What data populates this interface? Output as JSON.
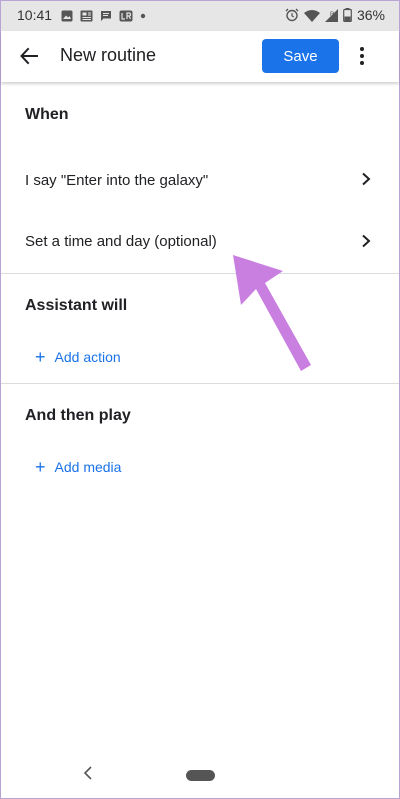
{
  "status_bar": {
    "time": "10:41",
    "battery": "36%",
    "icons_left": [
      "image-icon",
      "news-icon",
      "message-icon",
      "lr-icon",
      "dot-icon"
    ],
    "icons_right": [
      "alarm-icon",
      "wifi-icon",
      "signal-icon",
      "battery-icon"
    ]
  },
  "appbar": {
    "title": "New routine",
    "save_label": "Save"
  },
  "sections": {
    "when": {
      "title": "When",
      "items": [
        {
          "label": "I say \"Enter into the galaxy\""
        },
        {
          "label": "Set a time and day (optional)"
        }
      ]
    },
    "assistant_will": {
      "title": "Assistant will",
      "add_label": "Add action"
    },
    "and_then_play": {
      "title": "And then play",
      "add_label": "Add media"
    }
  },
  "colors": {
    "accent": "#1a73e8",
    "annotation": "#c97fe0"
  }
}
